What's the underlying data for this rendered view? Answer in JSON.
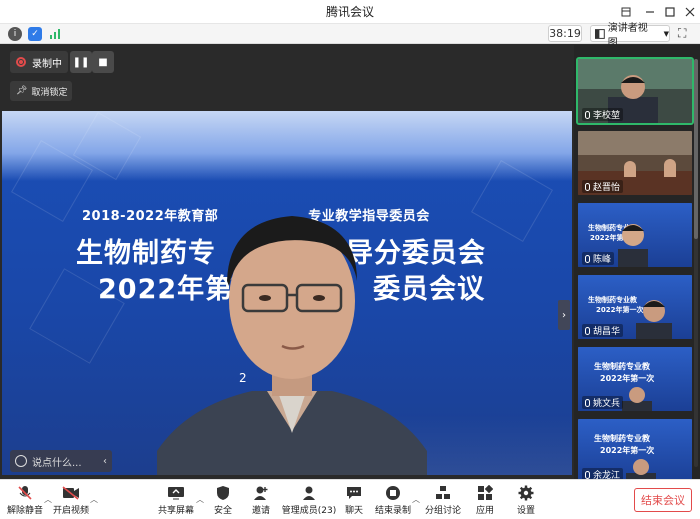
{
  "window": {
    "title": "腾讯会议"
  },
  "infobar": {
    "timer": "38:19",
    "view_label": "演讲者视图"
  },
  "recording": {
    "label": "录制中",
    "unlock_label": "取消锁定"
  },
  "slide": {
    "line1": "2018-2022年教育部",
    "line1b": "专业教学指导委员会",
    "line2a": "生物制药专",
    "line2b": "导分委员会",
    "line3a": "2022年第",
    "line3b": "委员会议",
    "line4": "2"
  },
  "chat": {
    "placeholder": "说点什么..."
  },
  "participants": [
    {
      "name": "李校堃"
    },
    {
      "name": "赵晋怡"
    },
    {
      "name": "陈峰"
    },
    {
      "name": "胡昌华"
    },
    {
      "name": "姚文兵"
    },
    {
      "name": "余龙江"
    }
  ],
  "toolbar": {
    "unmute": "解除静音",
    "start_video": "开启视频",
    "share_screen": "共享屏幕",
    "security": "安全",
    "invite": "邀请",
    "manage_members": "管理成员(23)",
    "chat": "聊天",
    "end_recording": "结束录制",
    "breakout": "分组讨论",
    "apps": "应用",
    "settings": "设置",
    "end_meeting": "结束会议"
  }
}
